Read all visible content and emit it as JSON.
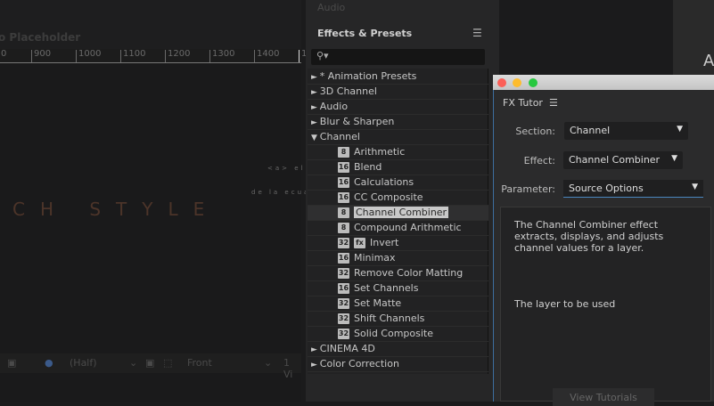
{
  "composition": {
    "title": "o Placeholder",
    "ruler_ticks": [
      "0",
      "900",
      "1000",
      "1100",
      "1200",
      "1300",
      "1400",
      "1"
    ],
    "style_text": "CH STYLE",
    "faint_text_1": "<a> el",
    "faint_text_2": "de la ecua"
  },
  "viewer_bar": {
    "resolution": "(Half)",
    "view": "Front",
    "views_count": "1 Vi"
  },
  "effects_panel": {
    "tab_above": "Audio",
    "title": "Effects & Presets",
    "menu_icon": "hamburger-icon",
    "search_placeholder": "",
    "items": [
      {
        "label": "* Animation Presets",
        "type": "folder",
        "expanded": false
      },
      {
        "label": "3D Channel",
        "type": "folder",
        "expanded": false
      },
      {
        "label": "Audio",
        "type": "folder",
        "expanded": false
      },
      {
        "label": "Blur & Sharpen",
        "type": "folder",
        "expanded": false
      },
      {
        "label": "Channel",
        "type": "folder",
        "expanded": true
      },
      {
        "label": "Arithmetic",
        "badge": "8"
      },
      {
        "label": "Blend",
        "badge": "16"
      },
      {
        "label": "Calculations",
        "badge": "16"
      },
      {
        "label": "CC Composite",
        "badge": "16"
      },
      {
        "label": "Channel Combiner",
        "badge": "8",
        "selected": true
      },
      {
        "label": "Compound Arithmetic",
        "badge": "8"
      },
      {
        "label": "Invert",
        "badge": "32",
        "extra_badge": "fx"
      },
      {
        "label": "Minimax",
        "badge": "16"
      },
      {
        "label": "Remove Color Matting",
        "badge": "32"
      },
      {
        "label": "Set Channels",
        "badge": "16"
      },
      {
        "label": "Set Matte",
        "badge": "32"
      },
      {
        "label": "Shift Channels",
        "badge": "32"
      },
      {
        "label": "Solid Composite",
        "badge": "32"
      },
      {
        "label": "CINEMA 4D",
        "type": "folder",
        "expanded": false
      },
      {
        "label": "Color Correction",
        "type": "folder",
        "expanded": false
      }
    ]
  },
  "fx_tutor": {
    "title": "FX Tutor",
    "section_label": "Section:",
    "section_value": "Channel",
    "effect_label": "Effect:",
    "effect_value": "Channel Combiner",
    "parameter_label": "Parameter:",
    "parameter_value": "Source Options",
    "description": "The Channel Combiner effect extracts, displays, and adjusts channel values for a layer.",
    "parameter_description": "The layer to be used",
    "view_tutorials": "View Tutorials"
  },
  "right_panel": {
    "letter": "A"
  },
  "colors": {
    "accent_blue": "#3d6e9e",
    "close": "#fc5f57",
    "minimize": "#fdbc2e",
    "zoom": "#28c840"
  }
}
